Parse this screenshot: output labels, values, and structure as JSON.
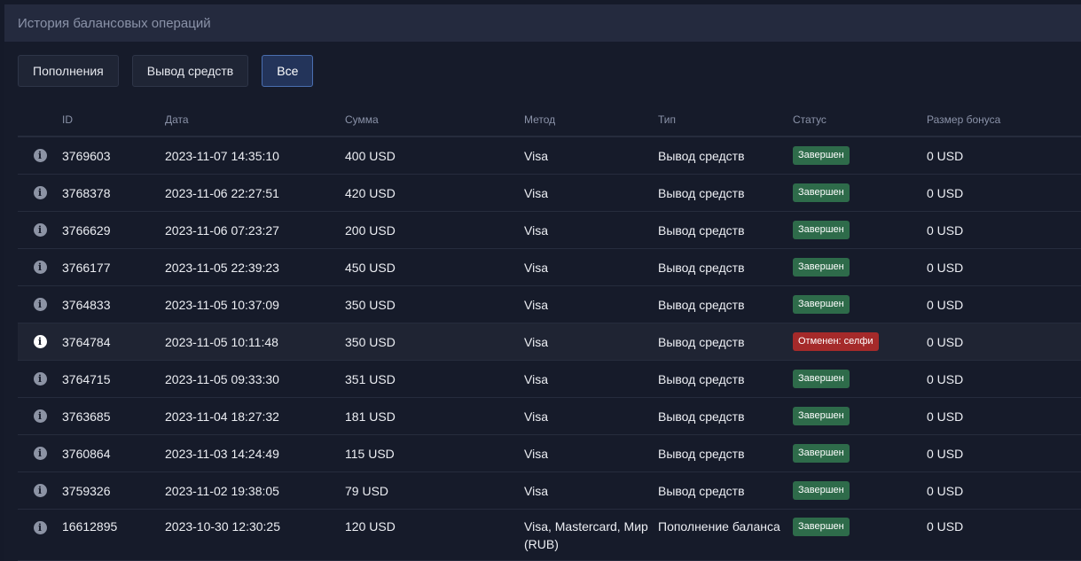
{
  "modal": {
    "title": "История балансовых операций"
  },
  "filters": {
    "deposits": "Пополнения",
    "withdrawals": "Вывод средств",
    "all": "Все"
  },
  "table": {
    "headers": {
      "id": "ID",
      "date": "Дата",
      "sum": "Сумма",
      "method": "Метод",
      "type": "Тип",
      "status": "Статус",
      "bonus": "Размер бонуса"
    },
    "rows": [
      {
        "id": "3769603",
        "date": "2023-11-07 14:35:10",
        "sum": "400 USD",
        "method": "Visa",
        "type": "Вывод средств",
        "status": "Завершен",
        "bonus": "0 USD"
      },
      {
        "id": "3768378",
        "date": "2023-11-06 22:27:51",
        "sum": "420 USD",
        "method": "Visa",
        "type": "Вывод средств",
        "status": "Завершен",
        "bonus": "0 USD"
      },
      {
        "id": "3766629",
        "date": "2023-11-06 07:23:27",
        "sum": "200 USD",
        "method": "Visa",
        "type": "Вывод средств",
        "status": "Завершен",
        "bonus": "0 USD"
      },
      {
        "id": "3766177",
        "date": "2023-11-05 22:39:23",
        "sum": "450 USD",
        "method": "Visa",
        "type": "Вывод средств",
        "status": "Завершен",
        "bonus": "0 USD"
      },
      {
        "id": "3764833",
        "date": "2023-11-05 10:37:09",
        "sum": "350 USD",
        "method": "Visa",
        "type": "Вывод средств",
        "status": "Завершен",
        "bonus": "0 USD"
      },
      {
        "id": "3764784",
        "date": "2023-11-05 10:11:48",
        "sum": "350 USD",
        "method": "Visa",
        "type": "Вывод средств",
        "status": "Отменен: селфи",
        "bonus": "0 USD"
      },
      {
        "id": "3764715",
        "date": "2023-11-05 09:33:30",
        "sum": "351 USD",
        "method": "Visa",
        "type": "Вывод средств",
        "status": "Завершен",
        "bonus": "0 USD"
      },
      {
        "id": "3763685",
        "date": "2023-11-04 18:27:32",
        "sum": "181 USD",
        "method": "Visa",
        "type": "Вывод средств",
        "status": "Завершен",
        "bonus": "0 USD"
      },
      {
        "id": "3760864",
        "date": "2023-11-03 14:24:49",
        "sum": "115 USD",
        "method": "Visa",
        "type": "Вывод средств",
        "status": "Завершен",
        "bonus": "0 USD"
      },
      {
        "id": "3759326",
        "date": "2023-11-02 19:38:05",
        "sum": "79 USD",
        "method": "Visa",
        "type": "Вывод средств",
        "status": "Завершен",
        "bonus": "0 USD"
      },
      {
        "id": "16612895",
        "date": "2023-10-30 12:30:25",
        "sum": "120 USD",
        "method": "Visa, Mastercard, Мир (RUB)",
        "type": "Пополнение баланса",
        "status": "Завершен",
        "bonus": "0 USD"
      }
    ]
  },
  "colors": {
    "status_ok": "#2e6b4a",
    "status_cancel": "#a52a2a",
    "active_filter_border": "#4a6fb0"
  },
  "icons": {
    "row_info": "info-icon"
  }
}
